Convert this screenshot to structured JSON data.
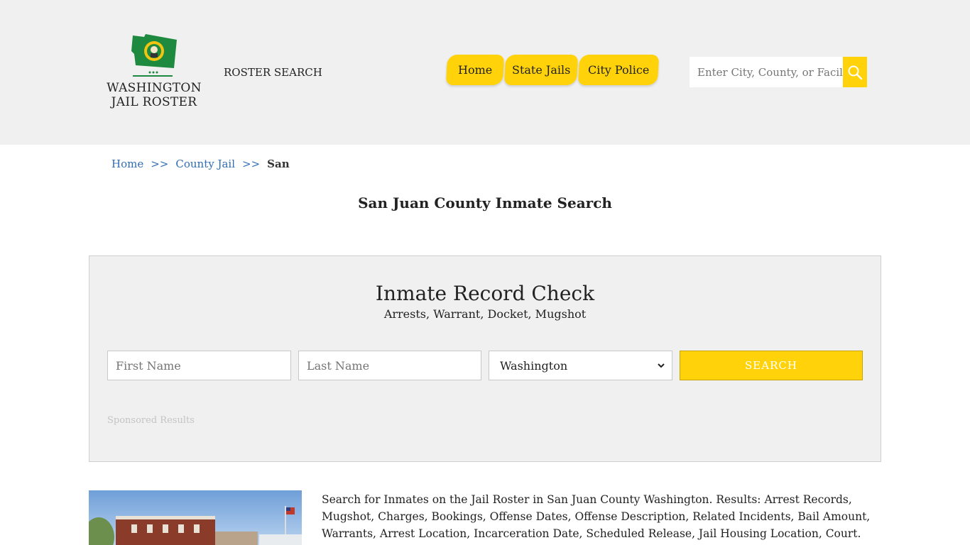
{
  "header": {
    "logo_line1": "WASHINGTON",
    "logo_line2": "JAIL ROSTER",
    "roster_search": "ROSTER SEARCH",
    "nav": [
      "Home",
      "State Jails",
      "City Police"
    ],
    "search_placeholder": "Enter City, County, or Facility"
  },
  "breadcrumb": {
    "home": "Home",
    "sep": ">>",
    "county": "County Jail",
    "current": "San"
  },
  "page_title": "San Juan County Inmate Search",
  "record_check": {
    "title": "Inmate Record Check",
    "subtitle": "Arrests, Warrant, Docket, Mugshot",
    "first_placeholder": "First Name",
    "last_placeholder": "Last Name",
    "state_value": "Washington",
    "search_label": "SEARCH",
    "sponsored": "Sponsored Results"
  },
  "description": "Search for Inmates on the Jail Roster in San Juan County Washington. Results: Arrest Records, Mugshot, Charges, Bookings, Offense Dates, Offense Description, Related Incidents, Bail Amount, Warrants, Arrest Location, Incarceration Date, Scheduled Release, Jail Housing Location, Court.",
  "colors": {
    "header_bg": "#f0f0f0",
    "accent_yellow": "#ffd20a",
    "link_blue": "#2f6db5",
    "flag_green": "#1e8a3f"
  }
}
